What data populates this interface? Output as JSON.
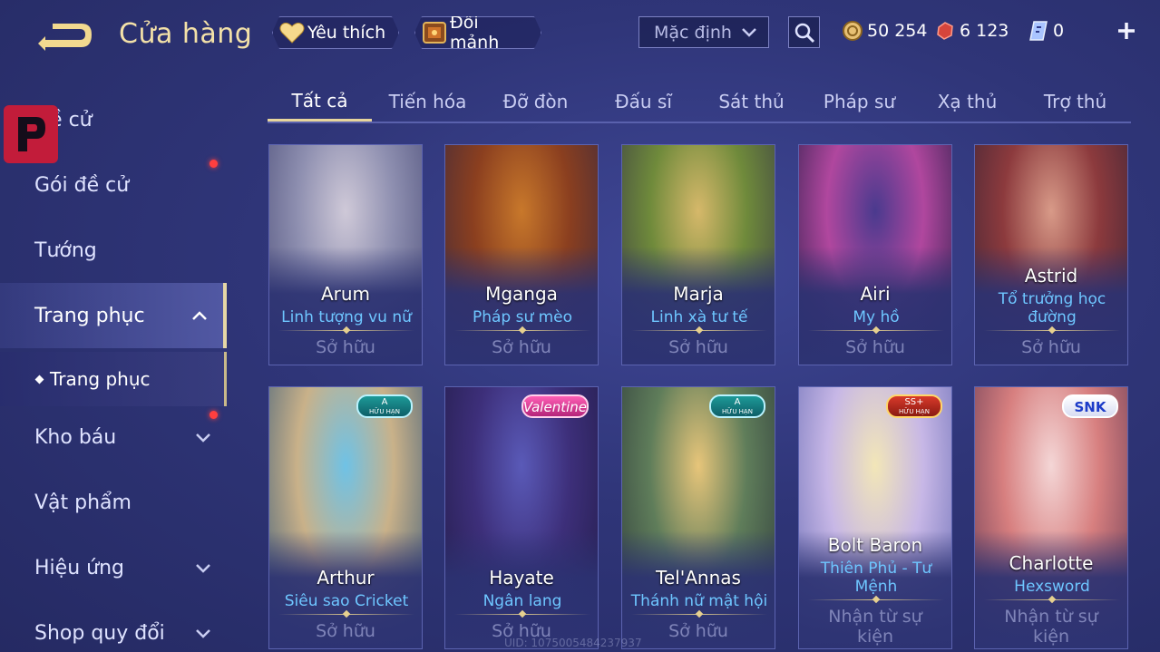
{
  "header": {
    "title": "Cửa hàng",
    "favorite_label": "Yêu thích",
    "shard_exchange_label": "Đổi mảnh",
    "sort": {
      "selected": "Mặc định"
    }
  },
  "currencies": {
    "gold": "50 254",
    "gems": "6 123",
    "cards": "0"
  },
  "sidebar": {
    "items": [
      {
        "label": "Đề cử"
      },
      {
        "label": "Gói đề cử"
      },
      {
        "label": "Tướng"
      },
      {
        "label": "Trang phục"
      },
      {
        "label": "Kho báu"
      },
      {
        "label": "Vật phẩm"
      },
      {
        "label": "Hiệu ứng"
      },
      {
        "label": "Shop quy đổi"
      }
    ],
    "sub_item": {
      "label": "Trang phục"
    }
  },
  "tabs": [
    {
      "label": "Tất cả"
    },
    {
      "label": "Tiến hóa"
    },
    {
      "label": "Đỡ đòn"
    },
    {
      "label": "Đấu sĩ"
    },
    {
      "label": "Sát thủ"
    },
    {
      "label": "Pháp sư"
    },
    {
      "label": "Xạ thủ"
    },
    {
      "label": "Trợ thủ"
    }
  ],
  "cards": [
    {
      "hero": "Arum",
      "skin": "Linh tượng vu nữ",
      "status": "Sở hữu",
      "colors": [
        "#cfc9d8",
        "#8e8fb0",
        "#4d4f7a"
      ]
    },
    {
      "hero": "Mganga",
      "skin": "Pháp sư mèo",
      "status": "Sở hữu",
      "colors": [
        "#c8782b",
        "#8b3f1f",
        "#3e2a3d"
      ]
    },
    {
      "hero": "Marja",
      "skin": "Linh xà tư tế",
      "status": "Sở hữu",
      "colors": [
        "#d6b86a",
        "#6f8a3b",
        "#3b3e44"
      ]
    },
    {
      "hero": "Airi",
      "skin": "My hồ",
      "status": "Sở hữu",
      "colors": [
        "#4a3a8e",
        "#b0479e",
        "#2a1e4a"
      ]
    },
    {
      "hero": "Astrid",
      "skin": "Tổ trưởng học đường",
      "status": "Sở hữu",
      "colors": [
        "#d89a88",
        "#8c3a3d",
        "#3b2436"
      ]
    },
    {
      "hero": "Arthur",
      "skin": "Siêu sao Cricket",
      "status": "Sở hữu",
      "badge": {
        "big": "A",
        "small": "HỮU HẠN"
      },
      "colors": [
        "#6fc2e6",
        "#c9b189",
        "#3e5d7a"
      ]
    },
    {
      "hero": "Hayate",
      "skin": "Ngân lang",
      "status": "Sở hữu",
      "badge": {
        "big": "Valentine",
        "small": ""
      },
      "colors": [
        "#5a5ab8",
        "#3d2f7a",
        "#221c48"
      ]
    },
    {
      "hero": "Tel'Annas",
      "skin": "Thánh nữ mật hội",
      "status": "Sở hữu",
      "badge": {
        "big": "A",
        "small": "HỮU HẠN"
      },
      "colors": [
        "#e7c57a",
        "#5f7d5a",
        "#2f3c3c"
      ]
    },
    {
      "hero": "Bolt Baron",
      "skin": "Thiên Phủ - Tư Mệnh",
      "status": "Nhận từ sự kiện",
      "badge": {
        "big": "SS+",
        "small": "HỮU HẠN"
      },
      "colors": [
        "#f2e6b8",
        "#c7b7e6",
        "#6a6eb6"
      ]
    },
    {
      "hero": "Charlotte",
      "skin": "Hexsword",
      "status": "Nhận từ sự kiện",
      "badge": {
        "big": "SNK",
        "small": ""
      },
      "colors": [
        "#f4d6d6",
        "#d77f7f",
        "#6a3c55"
      ]
    }
  ],
  "footer": {
    "uid": "UID: 1075005484237937"
  }
}
